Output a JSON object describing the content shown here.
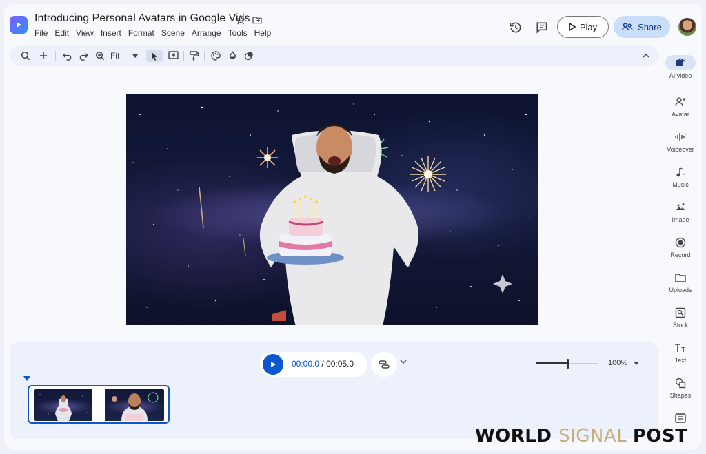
{
  "header": {
    "title": "Introducing Personal Avatars in Google Vids",
    "menu": [
      "File",
      "Edit",
      "View",
      "Insert",
      "Format",
      "Scene",
      "Arrange",
      "Tools",
      "Help"
    ],
    "play_label": "Play",
    "share_label": "Share"
  },
  "toolbar": {
    "zoom_label": "Fit"
  },
  "rail": [
    {
      "label": "AI video",
      "icon": "ai-video-icon"
    },
    {
      "label": "Avatar",
      "icon": "avatar-icon"
    },
    {
      "label": "Voiceover",
      "icon": "voiceover-icon"
    },
    {
      "label": "Music",
      "icon": "music-icon"
    },
    {
      "label": "Image",
      "icon": "image-icon"
    },
    {
      "label": "Record",
      "icon": "record-icon"
    },
    {
      "label": "Uploads",
      "icon": "uploads-icon"
    },
    {
      "label": "Stock",
      "icon": "stock-icon"
    },
    {
      "label": "Text",
      "icon": "text-icon"
    },
    {
      "label": "Shapes",
      "icon": "shapes-icon"
    }
  ],
  "timeline": {
    "current_time": "00:00.0",
    "separator": " / ",
    "total_time": "00:05.0",
    "zoom_level": "100%",
    "zoom_fraction": 0.5
  },
  "watermark": {
    "part1": "WORLD ",
    "part2": "SIGNAL ",
    "part3": "POST"
  },
  "colors": {
    "accent": "#0b57d0",
    "share_bg": "#c9def9"
  }
}
